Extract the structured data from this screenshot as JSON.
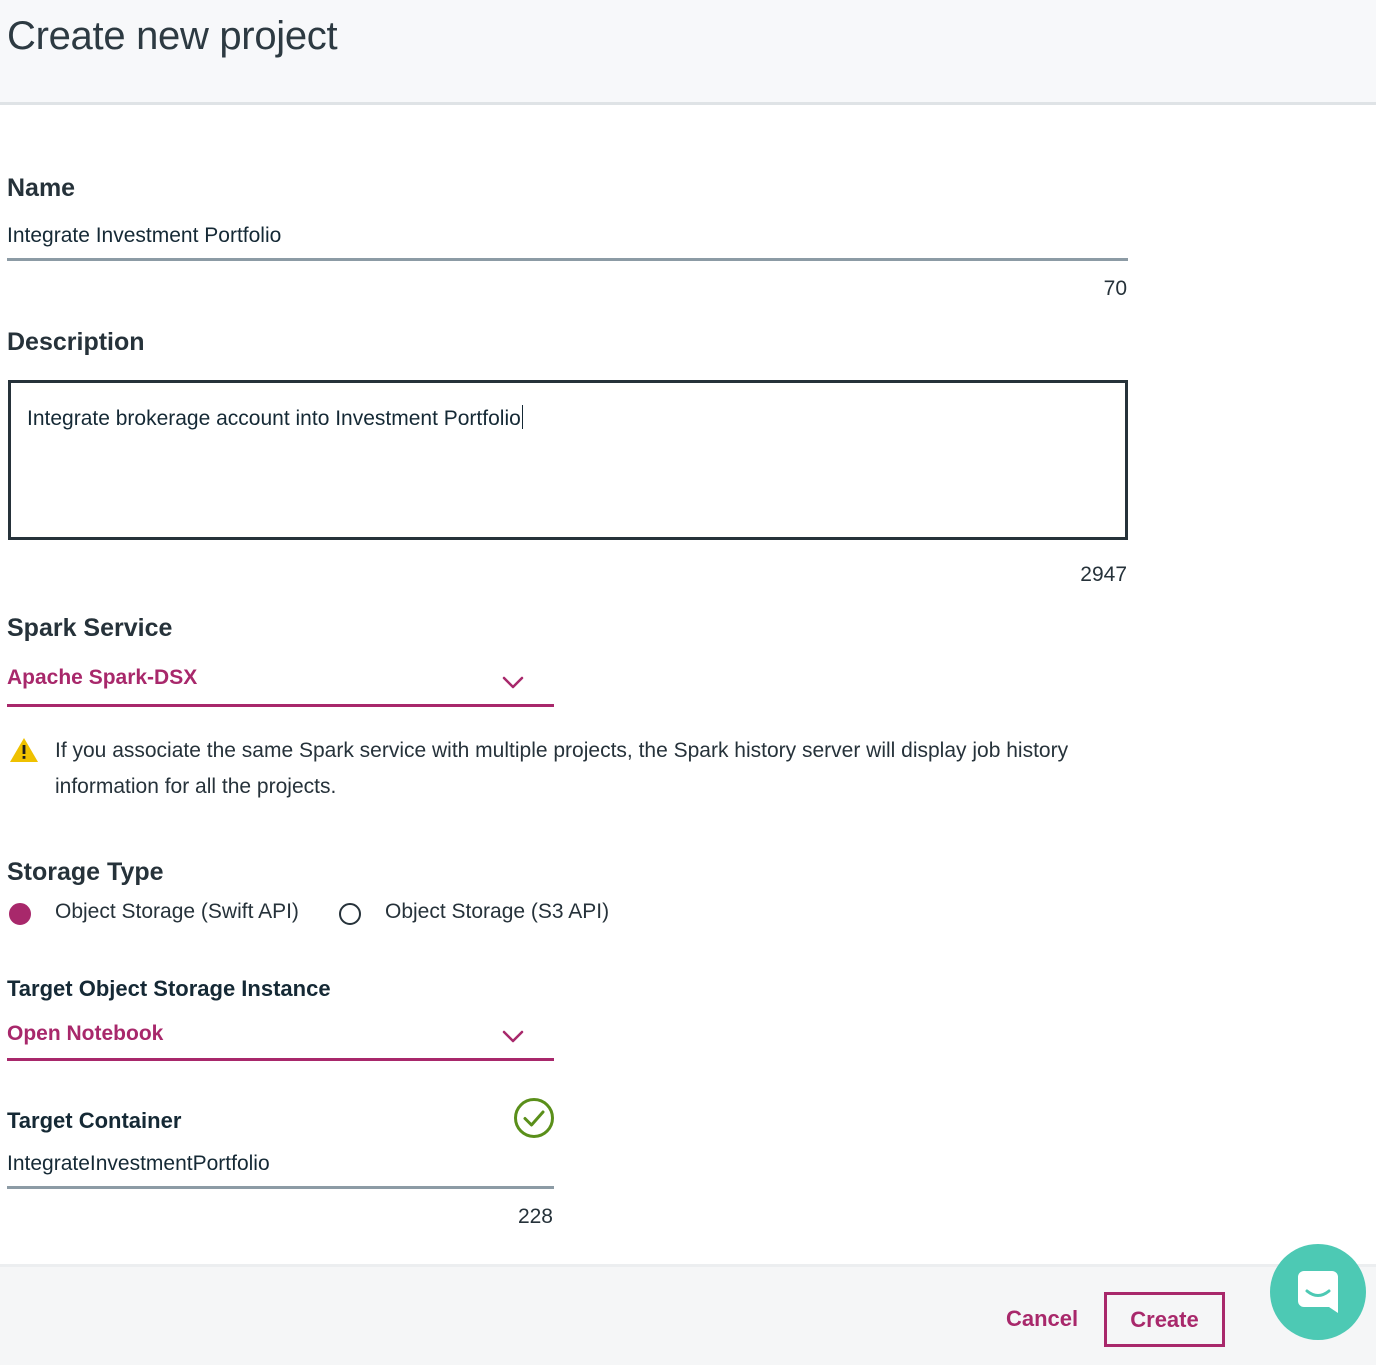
{
  "header": {
    "title": "Create new project"
  },
  "form": {
    "name": {
      "label": "Name",
      "value": "Integrate Investment Portfolio",
      "remaining": "70"
    },
    "description": {
      "label": "Description",
      "value": "Integrate brokerage account into Investment Portfolio",
      "remaining": "2947"
    },
    "spark_service": {
      "label": "Spark Service",
      "selected": "Apache Spark-DSX",
      "warning": "If you associate the same Spark service with multiple projects, the Spark history server will display job history information for all the projects."
    },
    "storage_type": {
      "label": "Storage Type",
      "options": [
        {
          "label": "Object Storage (Swift API)",
          "checked": true
        },
        {
          "label": "Object Storage (S3 API)",
          "checked": false
        }
      ]
    },
    "target_instance": {
      "label": "Target Object Storage Instance",
      "selected": "Open Notebook"
    },
    "target_container": {
      "label": "Target Container",
      "value": "IntegrateInvestmentPortfolio",
      "remaining": "228",
      "status_icon": "check-circle-icon"
    }
  },
  "footer": {
    "cancel_label": "Cancel",
    "create_label": "Create"
  },
  "chat": {
    "icon": "chat-bubble-icon"
  },
  "colors": {
    "accent": "#a8286b",
    "text_dark": "#152935",
    "header_bg": "#f7f8fa",
    "success": "#5a8f1a",
    "warning": "#efc100",
    "chat_bg": "#4dc9b4"
  }
}
